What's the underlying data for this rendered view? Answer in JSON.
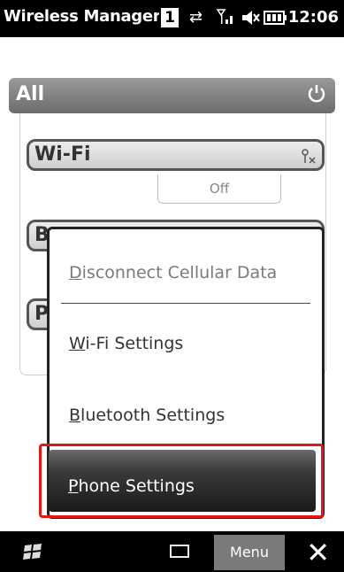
{
  "status_bar": {
    "title": "Wireless Manager",
    "notification_count": "1",
    "time": "12:06",
    "icons": [
      "data-transfer-icon",
      "signal-icon",
      "speaker-mute-icon",
      "battery-icon"
    ]
  },
  "panel": {
    "header": "All",
    "header_icon": "power-icon",
    "wifi_label": "Wi-Fi",
    "wifi_status": "Off",
    "wifi_icon": "wifi-off-icon",
    "bluetooth_label_partial": "B",
    "phone_label_partial": "P"
  },
  "menu": {
    "items": [
      {
        "label_first": "D",
        "label_rest": "isconnect Cellular Data",
        "enabled": false
      },
      {
        "label_first": "W",
        "label_rest": "i-Fi Settings",
        "enabled": true
      },
      {
        "label_first": "B",
        "label_rest": "luetooth Settings",
        "enabled": true
      },
      {
        "label_first": "P",
        "label_rest": "hone Settings",
        "enabled": true,
        "selected": true
      }
    ]
  },
  "bottom_bar": {
    "start_icon": "windows-start-icon",
    "keyboard_icon": "keyboard-icon",
    "menu_label": "Menu",
    "close_icon": "close-icon"
  },
  "colors": {
    "highlight_border": "#e01818",
    "bar_background": "#000000"
  }
}
